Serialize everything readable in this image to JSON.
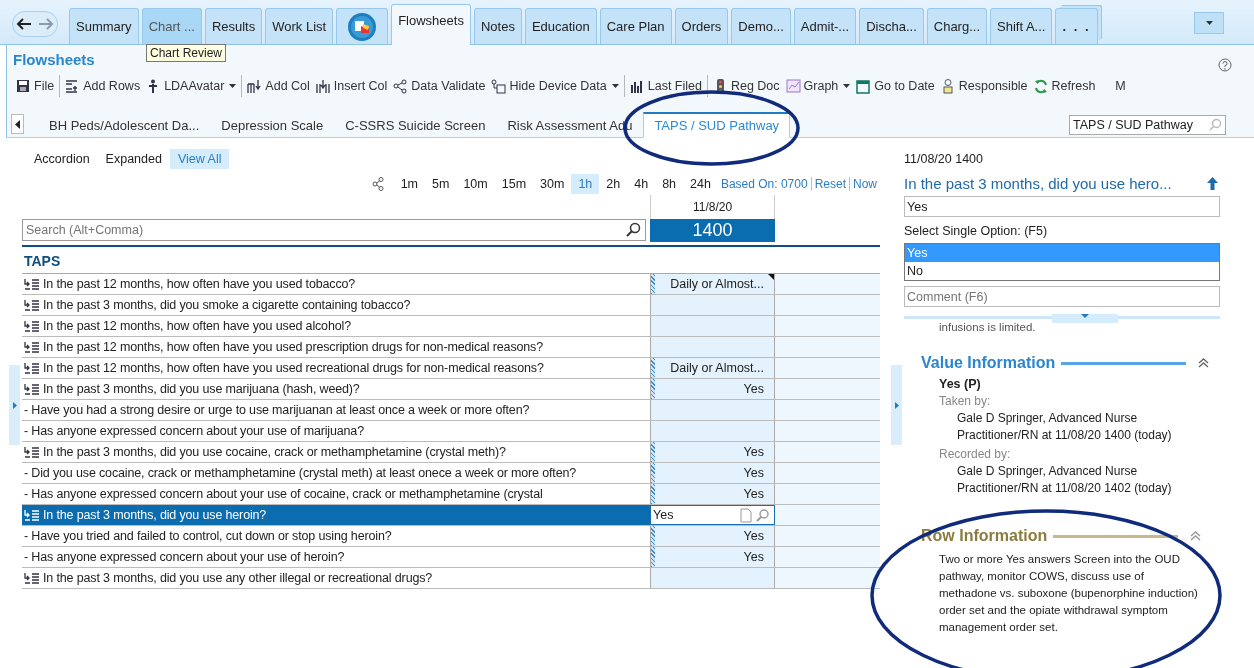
{
  "top_tabs": [
    {
      "kind": "nav"
    },
    {
      "kind": "text",
      "label": "Summary",
      "selected": false,
      "hovered": false
    },
    {
      "kind": "text",
      "label": "Chart ...",
      "selected": false,
      "hovered": true
    },
    {
      "kind": "text",
      "label": "Results",
      "selected": false,
      "hovered": false
    },
    {
      "kind": "text",
      "label": "Work List",
      "selected": false,
      "hovered": false
    },
    {
      "kind": "icon",
      "selected": false,
      "hovered": false
    },
    {
      "kind": "text",
      "label": "Flowsheets",
      "selected": true,
      "hovered": false
    },
    {
      "kind": "text",
      "label": "Notes",
      "selected": false,
      "hovered": false
    },
    {
      "kind": "text",
      "label": "Education",
      "selected": false,
      "hovered": false
    },
    {
      "kind": "text",
      "label": "Care Plan",
      "selected": false,
      "hovered": false
    },
    {
      "kind": "text",
      "label": "Orders",
      "selected": false,
      "hovered": false
    },
    {
      "kind": "text",
      "label": "Demo...",
      "selected": false,
      "hovered": false
    },
    {
      "kind": "text",
      "label": "Admit-...",
      "selected": false,
      "hovered": false
    },
    {
      "kind": "text",
      "label": "Discha...",
      "selected": false,
      "hovered": false
    },
    {
      "kind": "text",
      "label": "Charg...",
      "selected": false,
      "hovered": false
    },
    {
      "kind": "text",
      "label": "Shift A...",
      "selected": false,
      "hovered": false
    },
    {
      "kind": "more",
      "label": ". . .",
      "selected": false,
      "hovered": false
    }
  ],
  "tooltip": "Chart Review",
  "title": "Flowsheets",
  "toolbar": [
    [
      {
        "kind": "save",
        "label": "File",
        "dropdown": false
      }
    ],
    [
      {
        "kind": "rows",
        "label": "Add Rows",
        "dropdown": false
      },
      {
        "kind": "figure",
        "label": "LDAAvatar",
        "dropdown": true
      }
    ],
    [
      {
        "kind": "column",
        "label": "Add Col",
        "dropdown": false
      },
      {
        "kind": "insert",
        "label": "Insert Col",
        "dropdown": false
      },
      {
        "kind": "nodes",
        "label": "Data Validate",
        "dropdown": false
      },
      {
        "kind": "device",
        "label": "Hide Device Data",
        "dropdown": true
      }
    ],
    [
      {
        "kind": "bars",
        "label": "Last Filed",
        "dropdown": false
      }
    ],
    [
      {
        "kind": "traffic",
        "label": "Reg Doc",
        "dropdown": false
      },
      {
        "kind": "graph",
        "label": "Graph",
        "dropdown": true
      },
      {
        "kind": "calendar",
        "label": "Go to Date",
        "dropdown": false
      },
      {
        "kind": "person",
        "label": "Responsible",
        "dropdown": false
      },
      {
        "kind": "refresh",
        "label": "Refresh",
        "dropdown": false
      },
      {
        "kind": "plain",
        "label": "M",
        "dropdown": false
      }
    ]
  ],
  "sheet_tabs": [
    {
      "label": "BH Peds/Adolescent Da...",
      "selected": false,
      "circled": false
    },
    {
      "label": "Depression Scale",
      "selected": false,
      "circled": false
    },
    {
      "label": "C-SSRS Suicide Screen",
      "selected": false,
      "circled": false
    },
    {
      "label": "Risk Assessment Adu",
      "selected": false,
      "circled": false
    },
    {
      "label": "TAPS / SUD Pathway",
      "selected": true,
      "circled": true
    }
  ],
  "sheet_search": {
    "value": "TAPS / SUD Pathway"
  },
  "view_modes": [
    {
      "label": "Accordion",
      "selected": false
    },
    {
      "label": "Expanded",
      "selected": false
    },
    {
      "label": "View All",
      "selected": true
    }
  ],
  "intervals": [
    {
      "label": "1m",
      "selected": false
    },
    {
      "label": "5m",
      "selected": false
    },
    {
      "label": "10m",
      "selected": false
    },
    {
      "label": "15m",
      "selected": false
    },
    {
      "label": "30m",
      "selected": false
    },
    {
      "label": "1h",
      "selected": true
    },
    {
      "label": "2h",
      "selected": false
    },
    {
      "label": "4h",
      "selected": false
    },
    {
      "label": "8h",
      "selected": false
    },
    {
      "label": "24h",
      "selected": false
    }
  ],
  "interval_links": [
    "Based On: 0700",
    "Reset",
    "Now"
  ],
  "row_search": {
    "placeholder": "Search (Alt+Comma)"
  },
  "column": {
    "date": "11/8/20",
    "time": "1400"
  },
  "section": "TAPS",
  "rows": [
    {
      "kind": "question",
      "label": "In the past 12 months, how often have you used tobacco?",
      "value": "Daily or Almost...",
      "noted": true,
      "selected": false
    },
    {
      "kind": "question",
      "label": "In the past 3 months, did you smoke a cigarette containing tobacco?",
      "value": "",
      "noted": false,
      "selected": false
    },
    {
      "kind": "question",
      "label": "In the past 12 months, how often have you used alcohol?",
      "value": "",
      "noted": false,
      "selected": false
    },
    {
      "kind": "question",
      "label": "In the past 12 months, how often have you used prescription drugs for non-medical reasons?",
      "value": "",
      "noted": false,
      "selected": false
    },
    {
      "kind": "question",
      "label": "In the past 12 months, how often have you used recreational drugs for non-medical reasons?",
      "value": "Daily or Almost...",
      "noted": false,
      "selected": false
    },
    {
      "kind": "question",
      "label": "In the past 3 months, did you use marijuana (hash, weed)?",
      "value": "Yes",
      "noted": false,
      "selected": false
    },
    {
      "kind": "followup",
      "label": "- Have you had a strong desire or urge to use marijuanan at least once a week or more often?",
      "value": "",
      "noted": false,
      "selected": false
    },
    {
      "kind": "followup",
      "label": "- Has anyone expressed concern about your use of marijuana?",
      "value": "",
      "noted": false,
      "selected": false
    },
    {
      "kind": "question",
      "label": "In the past 3 months, did you use cocaine, crack or methamphetamine (crystal meth)?",
      "value": "Yes",
      "noted": false,
      "selected": false
    },
    {
      "kind": "followup",
      "label": "- Did you use cocaine, crack or methamphetamine (crystal meth) at least onece a week or more often?",
      "value": "Yes",
      "noted": false,
      "selected": false
    },
    {
      "kind": "followup",
      "label": "- Has anyone expressed concern about your use of cocaine, crack or methamphetamine (crystal",
      "value": "Yes",
      "noted": false,
      "selected": false
    },
    {
      "kind": "question",
      "label": "In the past 3 months, did you use heroin?",
      "value": "Yes",
      "noted": false,
      "selected": true
    },
    {
      "kind": "followup",
      "label": "- Have you tried and failed to control, cut down or stop using heroin?",
      "value": "Yes",
      "noted": false,
      "selected": false
    },
    {
      "kind": "followup",
      "label": "- Has anyone expressed concern about your use of heroin?",
      "value": "Yes",
      "noted": false,
      "selected": false
    },
    {
      "kind": "question",
      "label": "In the past 3 months, did you use any other illegal or recreational drugs?",
      "value": "",
      "noted": false,
      "selected": false
    }
  ],
  "detail": {
    "timestamp": "11/08/20 1400",
    "question": "In the past 3 months, did you use hero...",
    "value": "Yes",
    "options_label": "Select Single Option: (F5)",
    "options": [
      {
        "label": "Yes",
        "selected": true
      },
      {
        "label": "No",
        "selected": false
      }
    ],
    "comment": {
      "placeholder": "Comment (F6)"
    },
    "clipped_text": "infusions is limited.",
    "value_information": {
      "title": "Value Information",
      "value": "Yes (P)",
      "entries": [
        {
          "label": "Taken by:",
          "text": "Gale D Springer, Advanced Nurse Practitioner/RN at 11/08/20 1400 (today)"
        },
        {
          "label": "Recorded by:",
          "text": "Gale D Springer, Advanced Nurse Practitioner/RN at 11/08/20 1402 (today)"
        }
      ]
    },
    "row_information": {
      "circled": true,
      "title": "Row Information",
      "text": "Two or more Yes answers Screen into the OUD pathway, monitor COWS, discuss use of methadone vs. suboxone (bupenorphine induction) order set and the opiate withdrawal symptom management order set."
    }
  }
}
